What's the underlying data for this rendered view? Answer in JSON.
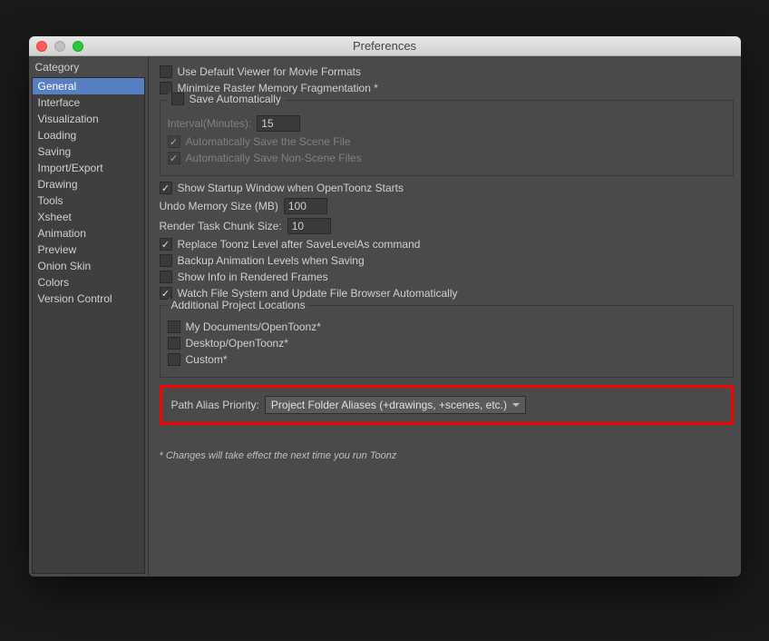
{
  "window": {
    "title": "Preferences"
  },
  "sidebar": {
    "label": "Category",
    "items": [
      "General",
      "Interface",
      "Visualization",
      "Loading",
      "Saving",
      "Import/Export",
      "Drawing",
      "Tools",
      "Xsheet",
      "Animation",
      "Preview",
      "Onion Skin",
      "Colors",
      "Version Control"
    ],
    "selectedIndex": 0
  },
  "content": {
    "useDefaultViewer": {
      "label": "Use Default Viewer for Movie Formats",
      "checked": false
    },
    "minimizeRaster": {
      "label": "Minimize Raster Memory Fragmentation *",
      "checked": false
    },
    "saveAuto": {
      "label": "Save Automatically",
      "checked": false,
      "intervalLabel": "Interval(Minutes):",
      "intervalValue": "15",
      "autoScene": {
        "label": "Automatically Save the Scene File",
        "checked": true
      },
      "autoNonScene": {
        "label": "Automatically Save Non-Scene Files",
        "checked": true
      }
    },
    "showStartup": {
      "label": "Show Startup Window when OpenToonz Starts",
      "checked": true
    },
    "undoMemLabel": "Undo Memory Size (MB)",
    "undoMemValue": "100",
    "renderChunkLabel": "Render Task Chunk Size:",
    "renderChunkValue": "10",
    "replaceToonz": {
      "label": "Replace Toonz Level after SaveLevelAs command",
      "checked": true
    },
    "backupAnim": {
      "label": "Backup Animation Levels when Saving",
      "checked": false
    },
    "showInfo": {
      "label": "Show Info in Rendered Frames",
      "checked": false
    },
    "watchFs": {
      "label": "Watch File System and Update File Browser Automatically",
      "checked": true
    },
    "addlLocations": {
      "label": "Additional Project Locations",
      "opts": [
        {
          "label": "My Documents/OpenToonz*",
          "checked": false
        },
        {
          "label": "Desktop/OpenToonz*",
          "checked": false
        },
        {
          "label": "Custom*",
          "checked": false
        }
      ]
    },
    "pathAlias": {
      "label": "Path Alias Priority:",
      "value": "Project Folder Aliases (+drawings, +scenes, etc.)"
    },
    "footnote": "* Changes will take effect the next time you run Toonz"
  }
}
